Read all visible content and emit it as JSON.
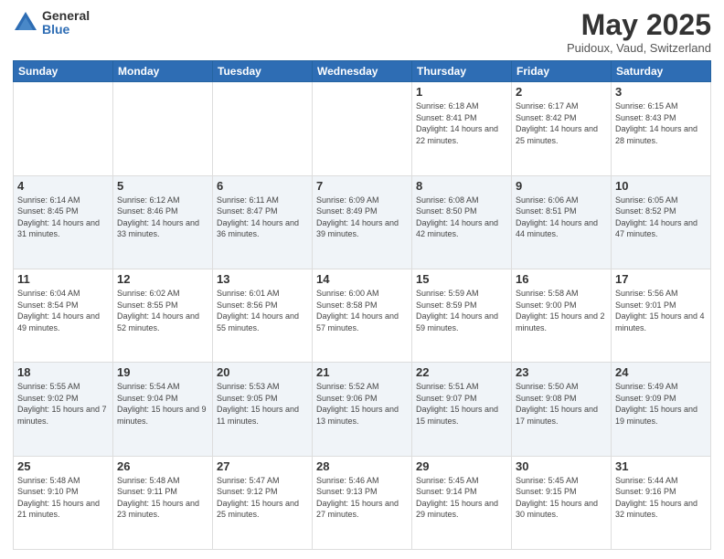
{
  "logo": {
    "general": "General",
    "blue": "Blue"
  },
  "header": {
    "month": "May 2025",
    "location": "Puidoux, Vaud, Switzerland"
  },
  "weekdays": [
    "Sunday",
    "Monday",
    "Tuesday",
    "Wednesday",
    "Thursday",
    "Friday",
    "Saturday"
  ],
  "weeks": [
    [
      {
        "day": "",
        "detail": ""
      },
      {
        "day": "",
        "detail": ""
      },
      {
        "day": "",
        "detail": ""
      },
      {
        "day": "",
        "detail": ""
      },
      {
        "day": "1",
        "detail": "Sunrise: 6:18 AM\nSunset: 8:41 PM\nDaylight: 14 hours\nand 22 minutes."
      },
      {
        "day": "2",
        "detail": "Sunrise: 6:17 AM\nSunset: 8:42 PM\nDaylight: 14 hours\nand 25 minutes."
      },
      {
        "day": "3",
        "detail": "Sunrise: 6:15 AM\nSunset: 8:43 PM\nDaylight: 14 hours\nand 28 minutes."
      }
    ],
    [
      {
        "day": "4",
        "detail": "Sunrise: 6:14 AM\nSunset: 8:45 PM\nDaylight: 14 hours\nand 31 minutes."
      },
      {
        "day": "5",
        "detail": "Sunrise: 6:12 AM\nSunset: 8:46 PM\nDaylight: 14 hours\nand 33 minutes."
      },
      {
        "day": "6",
        "detail": "Sunrise: 6:11 AM\nSunset: 8:47 PM\nDaylight: 14 hours\nand 36 minutes."
      },
      {
        "day": "7",
        "detail": "Sunrise: 6:09 AM\nSunset: 8:49 PM\nDaylight: 14 hours\nand 39 minutes."
      },
      {
        "day": "8",
        "detail": "Sunrise: 6:08 AM\nSunset: 8:50 PM\nDaylight: 14 hours\nand 42 minutes."
      },
      {
        "day": "9",
        "detail": "Sunrise: 6:06 AM\nSunset: 8:51 PM\nDaylight: 14 hours\nand 44 minutes."
      },
      {
        "day": "10",
        "detail": "Sunrise: 6:05 AM\nSunset: 8:52 PM\nDaylight: 14 hours\nand 47 minutes."
      }
    ],
    [
      {
        "day": "11",
        "detail": "Sunrise: 6:04 AM\nSunset: 8:54 PM\nDaylight: 14 hours\nand 49 minutes."
      },
      {
        "day": "12",
        "detail": "Sunrise: 6:02 AM\nSunset: 8:55 PM\nDaylight: 14 hours\nand 52 minutes."
      },
      {
        "day": "13",
        "detail": "Sunrise: 6:01 AM\nSunset: 8:56 PM\nDaylight: 14 hours\nand 55 minutes."
      },
      {
        "day": "14",
        "detail": "Sunrise: 6:00 AM\nSunset: 8:58 PM\nDaylight: 14 hours\nand 57 minutes."
      },
      {
        "day": "15",
        "detail": "Sunrise: 5:59 AM\nSunset: 8:59 PM\nDaylight: 14 hours\nand 59 minutes."
      },
      {
        "day": "16",
        "detail": "Sunrise: 5:58 AM\nSunset: 9:00 PM\nDaylight: 15 hours\nand 2 minutes."
      },
      {
        "day": "17",
        "detail": "Sunrise: 5:56 AM\nSunset: 9:01 PM\nDaylight: 15 hours\nand 4 minutes."
      }
    ],
    [
      {
        "day": "18",
        "detail": "Sunrise: 5:55 AM\nSunset: 9:02 PM\nDaylight: 15 hours\nand 7 minutes."
      },
      {
        "day": "19",
        "detail": "Sunrise: 5:54 AM\nSunset: 9:04 PM\nDaylight: 15 hours\nand 9 minutes."
      },
      {
        "day": "20",
        "detail": "Sunrise: 5:53 AM\nSunset: 9:05 PM\nDaylight: 15 hours\nand 11 minutes."
      },
      {
        "day": "21",
        "detail": "Sunrise: 5:52 AM\nSunset: 9:06 PM\nDaylight: 15 hours\nand 13 minutes."
      },
      {
        "day": "22",
        "detail": "Sunrise: 5:51 AM\nSunset: 9:07 PM\nDaylight: 15 hours\nand 15 minutes."
      },
      {
        "day": "23",
        "detail": "Sunrise: 5:50 AM\nSunset: 9:08 PM\nDaylight: 15 hours\nand 17 minutes."
      },
      {
        "day": "24",
        "detail": "Sunrise: 5:49 AM\nSunset: 9:09 PM\nDaylight: 15 hours\nand 19 minutes."
      }
    ],
    [
      {
        "day": "25",
        "detail": "Sunrise: 5:48 AM\nSunset: 9:10 PM\nDaylight: 15 hours\nand 21 minutes."
      },
      {
        "day": "26",
        "detail": "Sunrise: 5:48 AM\nSunset: 9:11 PM\nDaylight: 15 hours\nand 23 minutes."
      },
      {
        "day": "27",
        "detail": "Sunrise: 5:47 AM\nSunset: 9:12 PM\nDaylight: 15 hours\nand 25 minutes."
      },
      {
        "day": "28",
        "detail": "Sunrise: 5:46 AM\nSunset: 9:13 PM\nDaylight: 15 hours\nand 27 minutes."
      },
      {
        "day": "29",
        "detail": "Sunrise: 5:45 AM\nSunset: 9:14 PM\nDaylight: 15 hours\nand 29 minutes."
      },
      {
        "day": "30",
        "detail": "Sunrise: 5:45 AM\nSunset: 9:15 PM\nDaylight: 15 hours\nand 30 minutes."
      },
      {
        "day": "31",
        "detail": "Sunrise: 5:44 AM\nSunset: 9:16 PM\nDaylight: 15 hours\nand 32 minutes."
      }
    ]
  ]
}
